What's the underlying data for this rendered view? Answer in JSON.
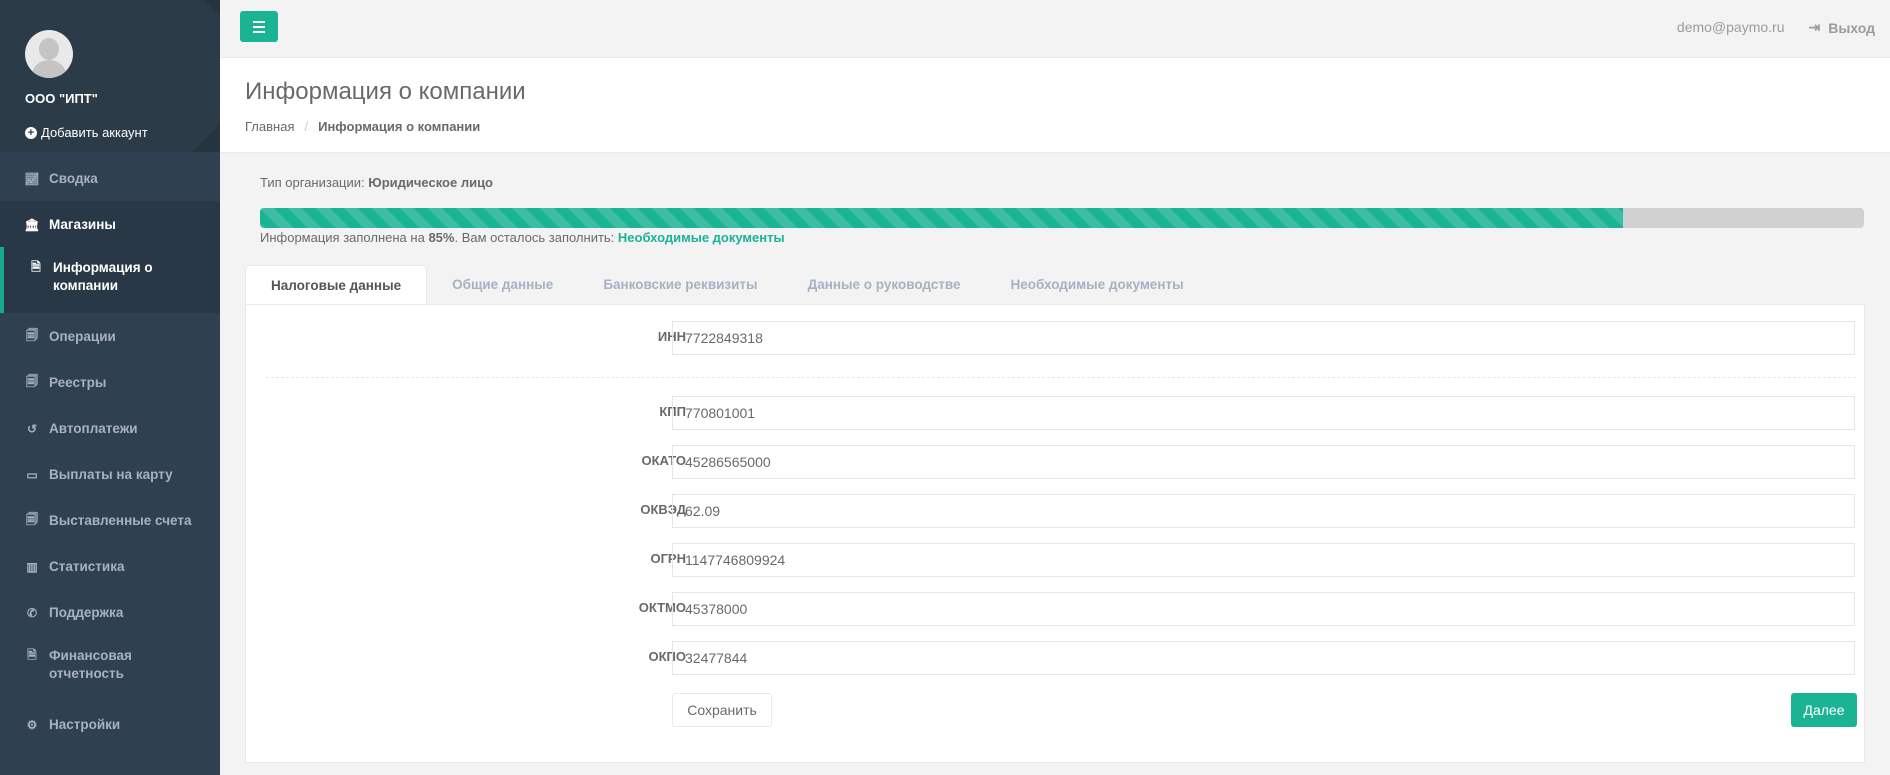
{
  "profile": {
    "company": "ООО \"ИПТ\"",
    "add_account": "Добавить аккаунт"
  },
  "nav": [
    {
      "label": "Сводка",
      "icon": "line-chart-icon"
    },
    {
      "label": "Магазины",
      "icon": "bank-icon"
    },
    {
      "label": "Информация о компании",
      "icon": "file-icon"
    },
    {
      "label": "Операции",
      "icon": "files-icon"
    },
    {
      "label": "Реестры",
      "icon": "files-icon"
    },
    {
      "label": "Автоплатежи",
      "icon": "history-icon"
    },
    {
      "label": "Выплаты на карту",
      "icon": "credit-card-icon"
    },
    {
      "label": "Выставленные счета",
      "icon": "files-icon"
    },
    {
      "label": "Статистика",
      "icon": "bar-chart-icon"
    },
    {
      "label": "Поддержка",
      "icon": "phone-icon"
    },
    {
      "label": "Финансовая отчетность",
      "icon": "file-icon"
    },
    {
      "label": "Настройки",
      "icon": "gear-icon"
    }
  ],
  "topbar": {
    "email": "demo@paymo.ru",
    "logout": "Выход"
  },
  "heading": {
    "title": "Информация о компании",
    "breadcrumb_home": "Главная",
    "breadcrumb_current": "Информация о компании"
  },
  "org": {
    "label": "Тип организации:",
    "value": "Юридическое лицо"
  },
  "progress": {
    "percent": 85,
    "text_before": "Информация заполнена на",
    "percent_label": "85%",
    "text_after": ". Вам осталось заполнить:",
    "link": "Необходимые документы"
  },
  "tabs": [
    "Налоговые данные",
    "Общие данные",
    "Банковские реквизиты",
    "Данные о руководстве",
    "Необходимые документы"
  ],
  "fields": {
    "inn": {
      "label": "ИНН",
      "value": "7722849318"
    },
    "kpp": {
      "label": "КПП",
      "value": "770801001"
    },
    "okato": {
      "label": "ОКАТО",
      "value": "45286565000"
    },
    "okved": {
      "label": "ОКВЭД",
      "value": "62.09"
    },
    "ogrn": {
      "label": "ОГРН",
      "value": "1147746809924"
    },
    "oktmo": {
      "label": "ОКТМО",
      "value": "45378000"
    },
    "okpo": {
      "label": "ОКПО",
      "value": "32477844"
    }
  },
  "buttons": {
    "save": "Сохранить",
    "next": "Далее"
  },
  "colors": {
    "accent": "#1ab394",
    "sidebar": "#2f4050"
  }
}
